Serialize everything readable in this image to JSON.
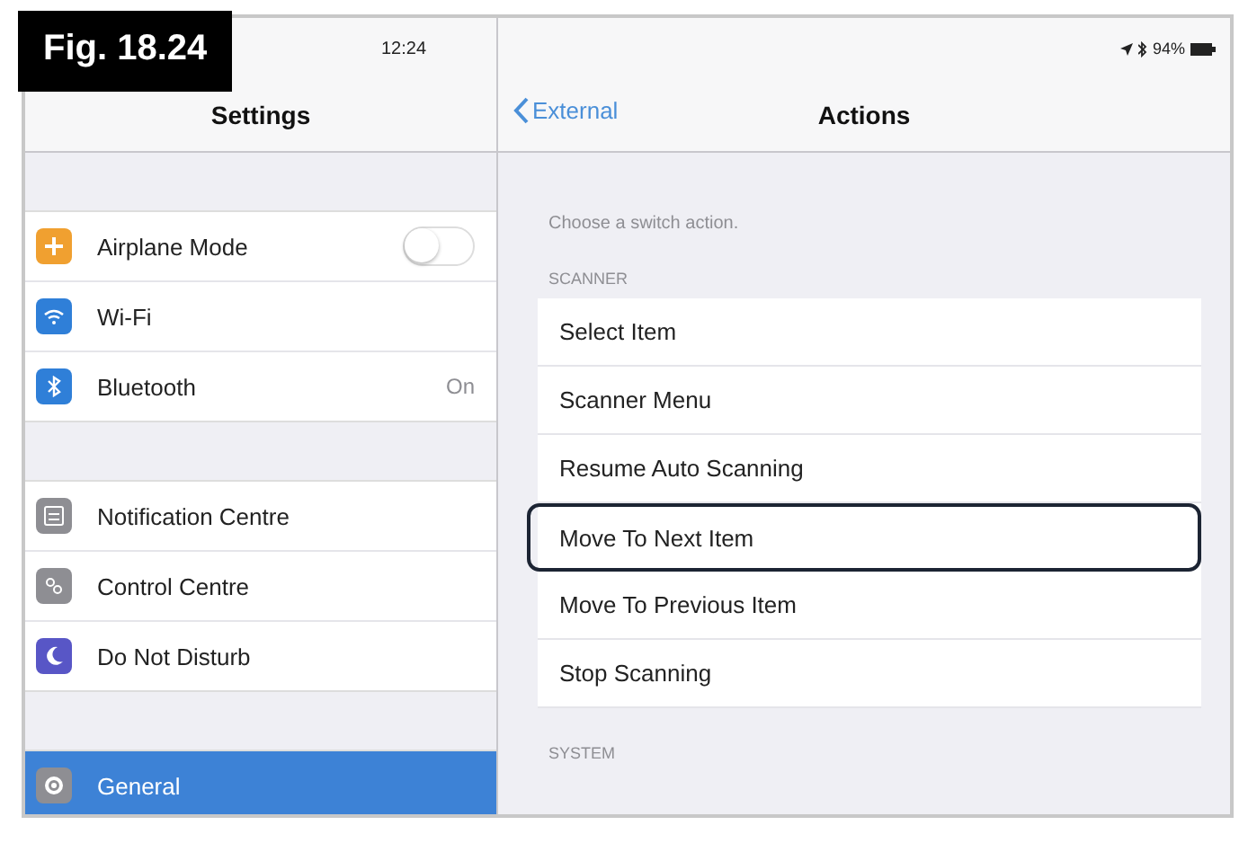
{
  "figure_label": "Fig. 18.24",
  "status_bar": {
    "time": "12:24",
    "battery": "94%"
  },
  "sidebar": {
    "title": "Settings",
    "groups": [
      {
        "items": [
          {
            "label": "Airplane Mode",
            "kind": "toggle",
            "on": false,
            "color": "#f0a030",
            "selected": false
          },
          {
            "label": "Wi-Fi",
            "kind": "plain",
            "color": "#2f7fd8",
            "selected": false
          },
          {
            "label": "Bluetooth",
            "kind": "value",
            "value": "On",
            "color": "#2f7fd8",
            "selected": false
          }
        ]
      },
      {
        "items": [
          {
            "label": "Notification Centre",
            "kind": "plain",
            "color": "#8e8e93",
            "selected": false
          },
          {
            "label": "Control Centre",
            "kind": "plain",
            "color": "#8e8e93",
            "selected": false
          },
          {
            "label": "Do Not Disturb",
            "kind": "plain",
            "color": "#5856c6",
            "selected": false
          }
        ]
      },
      {
        "items": [
          {
            "label": "General",
            "kind": "plain",
            "color": "#8e8e93",
            "selected": true
          }
        ]
      }
    ]
  },
  "detail": {
    "back": "External",
    "title": "Actions",
    "description": "Choose a switch action.",
    "sections": [
      {
        "header": "SCANNER",
        "items": [
          {
            "label": "Select Item",
            "focused": false
          },
          {
            "label": "Scanner Menu",
            "focused": false
          },
          {
            "label": "Resume Auto Scanning",
            "focused": false
          },
          {
            "label": "Move To Next Item",
            "focused": true
          },
          {
            "label": "Move To Previous Item",
            "focused": false
          },
          {
            "label": "Stop Scanning",
            "focused": false
          }
        ]
      },
      {
        "header": "SYSTEM"
      }
    ]
  }
}
